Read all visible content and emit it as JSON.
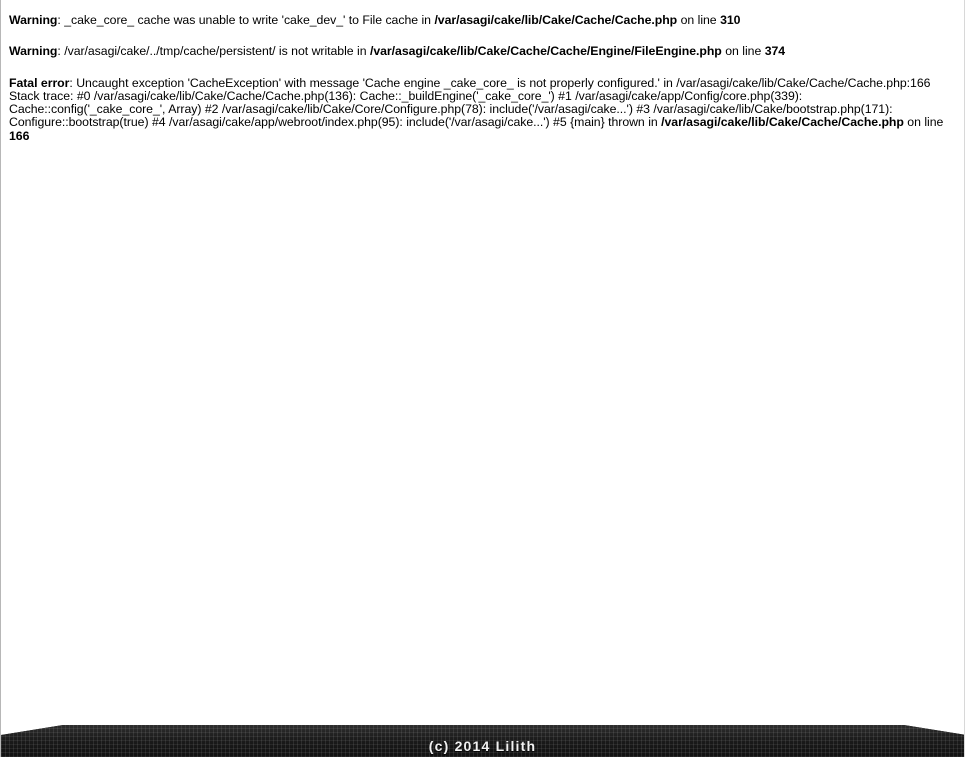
{
  "page": {
    "background_color": "#ffffff",
    "text_color": "#000000"
  },
  "messages": [
    {
      "id": "warning-cache-write",
      "label": "Warning",
      "text_before": ": _cake_core_ cache was unable to write 'cake_dev_' to File cache in ",
      "path": "/var/asagi/cake/lib/Cake/Cache/Cache.php",
      "text_middle": " on line ",
      "line": "310"
    },
    {
      "id": "warning-not-writable",
      "label": "Warning",
      "text_before": ": /var/asagi/cake/../tmp/cache/persistent/ is not writable in ",
      "path": "/var/asagi/cake/lib/Cake/Cache/Cache/Engine/FileEngine.php",
      "text_middle": " on line ",
      "line": "374"
    }
  ],
  "fatal": {
    "id": "fatal-error-cacheexception",
    "label": "Fatal error",
    "text_before": ": Uncaught exception 'CacheException' with message 'Cache engine _cake_core_ is not properly configured.' in /var/asagi/cake/lib/Cake/Cache/Cache.php:166 Stack trace: #0 /var/asagi/cake/lib/Cake/Cache/Cache.php(136): Cache::_buildEngine('_cake_core_') #1 /var/asagi/cake/app/Config/core.php(339): Cache::config('_cake_core_', Array) #2 /var/asagi/cake/lib/Cake/Core/Configure.php(78): include('/var/asagi/cake...') #3 /var/asagi/cake/lib/Cake/bootstrap.php(171): Configure::bootstrap(true) #4 /var/asagi/cake/app/webroot/index.php(95): include('/var/asagi/cake...') #5 {main} thrown in ",
    "path": "/var/asagi/cake/lib/Cake/Cache/Cache.php",
    "text_middle": " on line ",
    "line": "166"
  },
  "footer": {
    "credit": "(c) 2014 Lilith",
    "band_color": "#1c1c1c",
    "text_color": "#f2f2f2"
  }
}
